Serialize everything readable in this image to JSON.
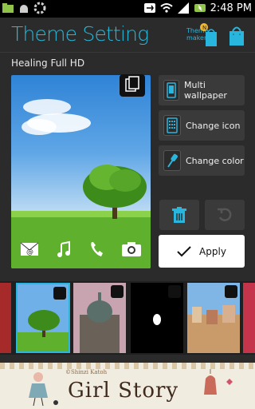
{
  "status": {
    "time": "2:48 PM"
  },
  "header": {
    "title": "Theme Setting",
    "theme_maker_label": "Theme maker"
  },
  "theme": {
    "name": "Healing Full HD"
  },
  "actions": {
    "multi_wallpaper": "Multi wallpaper",
    "change_icon": "Change icon",
    "change_color": "Change color",
    "apply": "Apply"
  },
  "ad": {
    "copyright": "©Shinzi Katoh",
    "title": "Girl Story"
  },
  "colors": {
    "accent": "#27b7d7",
    "background": "#2b2b2b",
    "button": "#3a3a3a"
  }
}
